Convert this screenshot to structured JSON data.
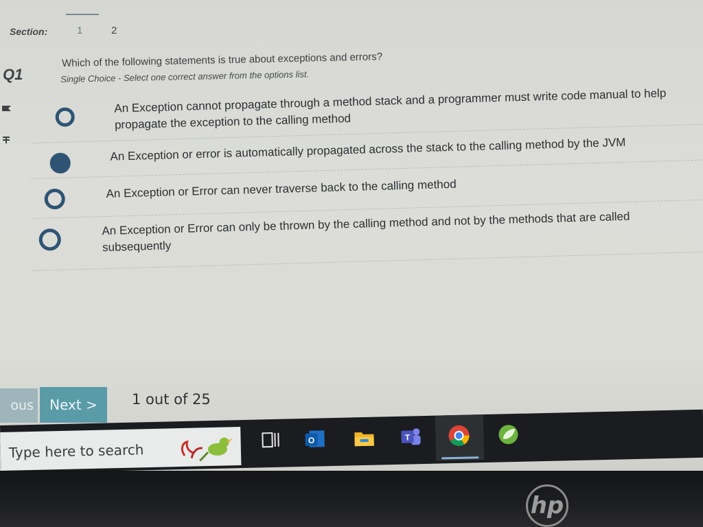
{
  "section": {
    "label": "Section:",
    "tabs": [
      "1",
      "2"
    ],
    "active_tab": "1"
  },
  "question": {
    "number": "Q1",
    "text": "Which of the following statements is true about exceptions and errors?",
    "instruction": "Single Choice - Select one correct answer from the options list.",
    "options": [
      {
        "text_line1": "An Exception cannot propagate through a method stack and a programmer must write code manual to help",
        "text_line2": "propagate the exception to the calling method",
        "selected": false
      },
      {
        "text_line1": "An Exception or error is automatically propagated across the stack to the calling method by the JVM",
        "text_line2": "",
        "selected": true
      },
      {
        "text_line1": "An Exception or Error can never traverse back to the calling method",
        "text_line2": "",
        "selected": false
      },
      {
        "text_line1": "An Exception or Error can only be thrown by the calling method and not by the methods that are called",
        "text_line2": "subsequently",
        "selected": false
      }
    ]
  },
  "navigation": {
    "previous_label": "ous",
    "next_label": "Next >",
    "progress": "1 out of 25"
  },
  "taskbar": {
    "search_placeholder": "Type here to search",
    "icons": [
      "task-view-icon",
      "outlook-icon",
      "file-explorer-icon",
      "teams-icon",
      "chrome-icon",
      "spring-tools-icon"
    ]
  },
  "colors": {
    "radio": "#2f5473",
    "next_button": "#5a9ba8",
    "taskbar": "#1a1c1f"
  },
  "hardware": {
    "logo": "hp"
  }
}
